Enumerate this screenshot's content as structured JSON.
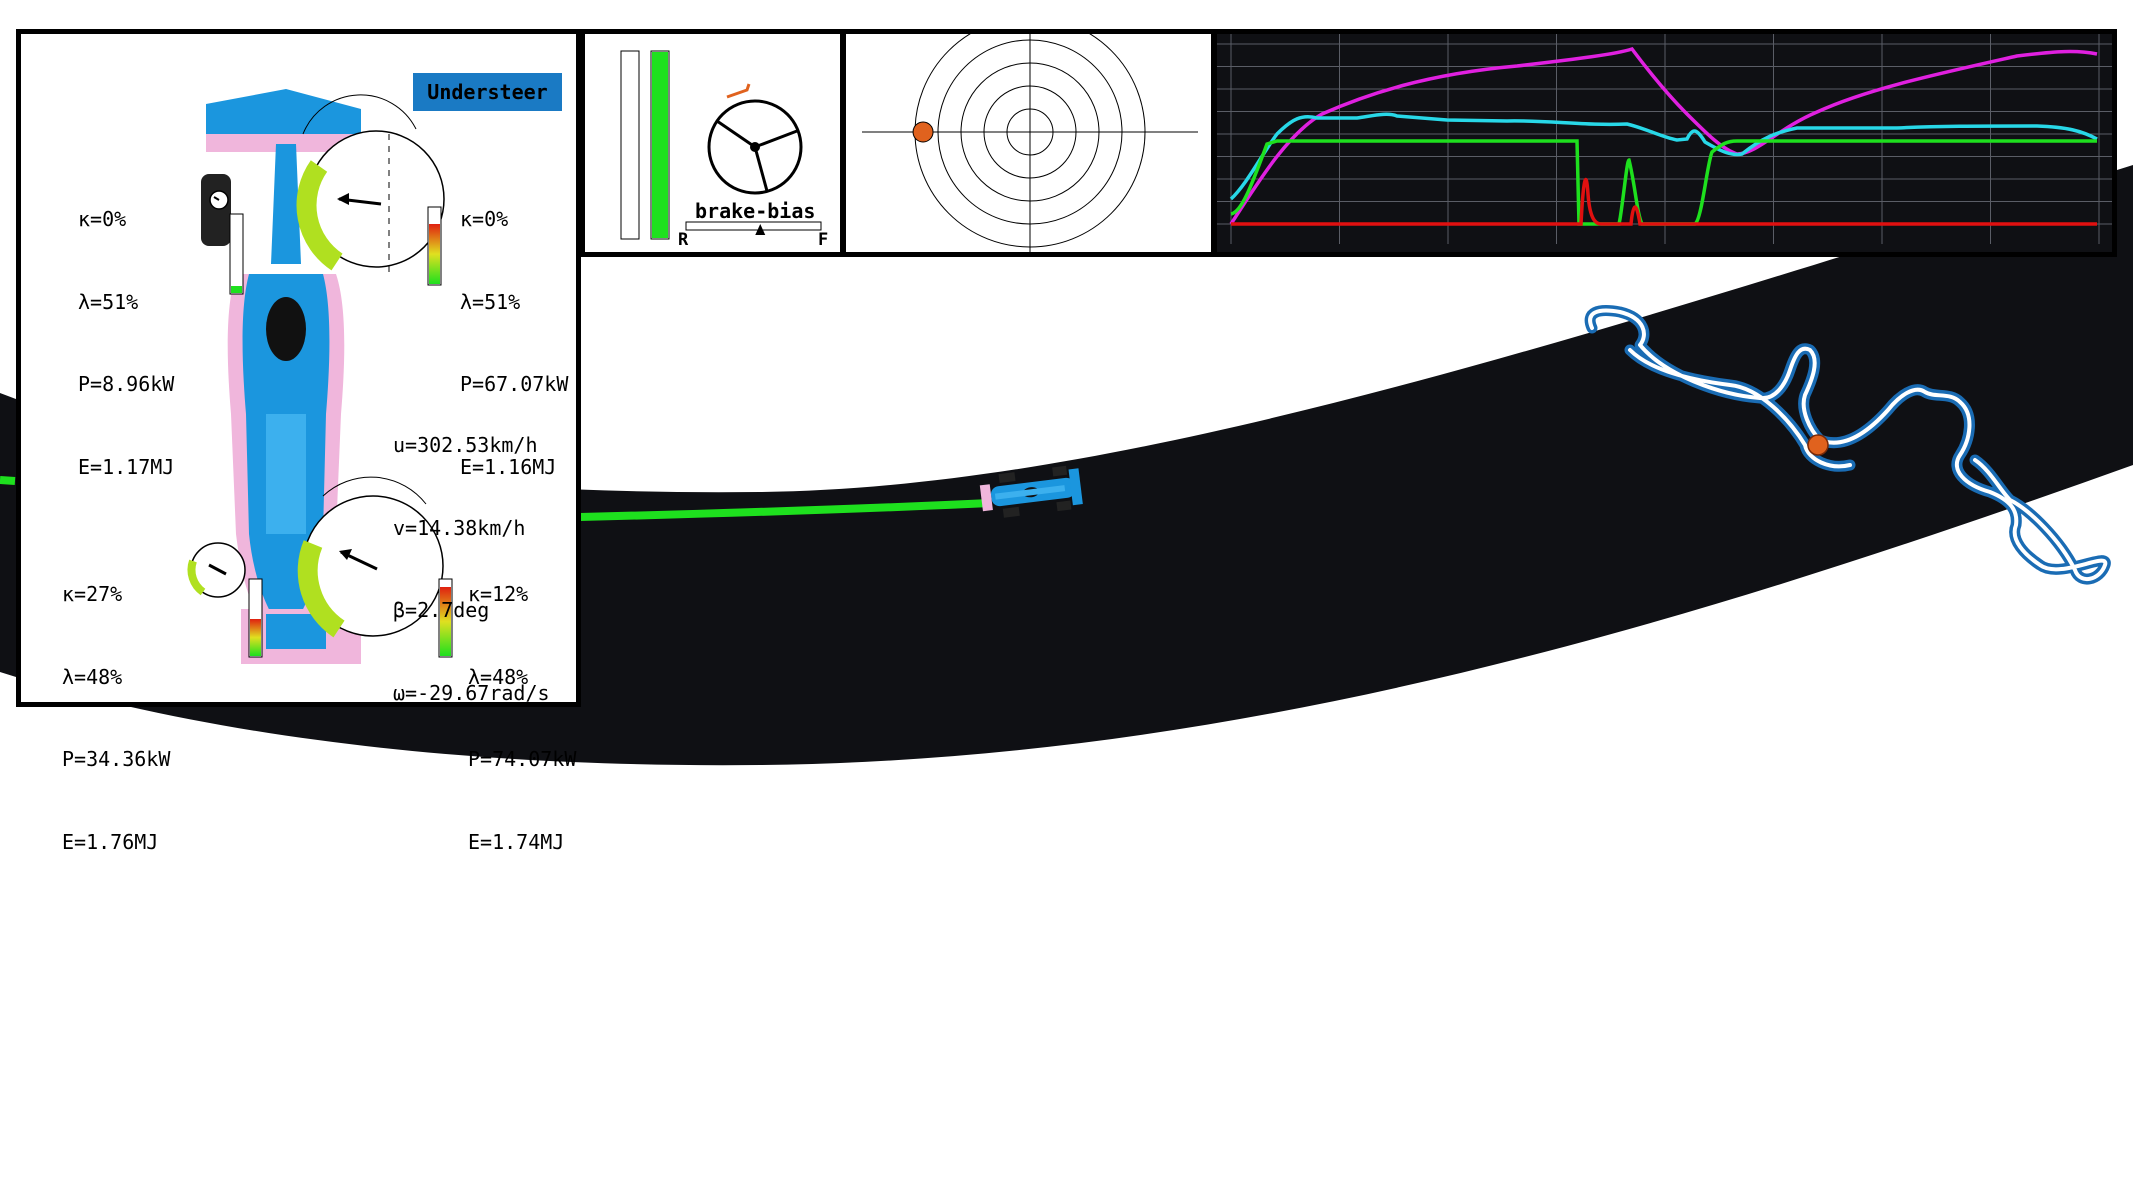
{
  "balance_badge": "Understeer",
  "colors": {
    "track": "#0f1014",
    "driven_line": "#1ee01e",
    "car_livery_blue": "#1b96de",
    "car_livery_pink": "#f0b6dc",
    "badge_blue": "#1a7ac4",
    "map_outline": "#1a6cb4",
    "position_marker": "#e0621e"
  },
  "tyres": {
    "front_left": {
      "slip_ratio": "κ=0%",
      "slip_angle": "λ=51%",
      "power": "P=8.96kW",
      "energy": "E=1.17MJ",
      "load_gauge": 0.15
    },
    "front_right": {
      "slip_ratio": "κ=0%",
      "slip_angle": "λ=51%",
      "power": "P=67.07kW",
      "energy": "E=1.16MJ",
      "load_gauge": 0.7
    },
    "rear_left": {
      "slip_ratio": "κ=27%",
      "slip_angle": "λ=48%",
      "power": "P=34.36kW",
      "energy": "E=1.76MJ",
      "load_gauge": 0.5
    },
    "rear_right": {
      "slip_ratio": "κ=12%",
      "slip_angle": "λ=48%",
      "power": "P=74.07kW",
      "energy": "E=1.74MJ",
      "load_gauge": 0.9
    }
  },
  "vehicle_state": {
    "u": "u=302.53km/h",
    "v": "v=14.38km/h",
    "beta": "β=2.7deg",
    "omega": "ω=-29.67rad/s"
  },
  "pedals": {
    "brake": 0.0,
    "throttle": 1.0
  },
  "brake_bias": {
    "label": "brake-bias",
    "rear_label": "R",
    "front_label": "F",
    "value": 0.55
  },
  "steering": {
    "angle_deg": -35
  },
  "gg_diagram": {
    "lateral_g_fraction": -0.93,
    "longitudinal_g_fraction": 0.0
  },
  "telemetry": {
    "series": [
      {
        "key": "speed",
        "color": "#e020e0"
      },
      {
        "key": "rpm",
        "color": "#28d8e8"
      },
      {
        "key": "throttle",
        "color": "#1ee01e"
      },
      {
        "key": "brake",
        "color": "#e01010"
      }
    ]
  },
  "track_map": {
    "marker_progress": 0.42
  }
}
